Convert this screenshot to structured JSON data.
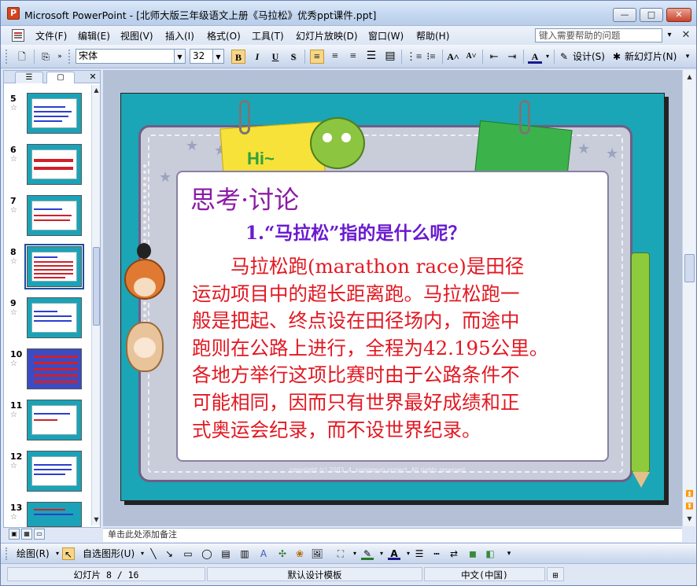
{
  "window": {
    "title": "Microsoft PowerPoint - [北师大版三年级语文上册《马拉松》优秀ppt课件.ppt]",
    "minimize": "—",
    "maximize": "□",
    "close": "✕"
  },
  "menu": {
    "items": [
      "文件(F)",
      "编辑(E)",
      "视图(V)",
      "插入(I)",
      "格式(O)",
      "工具(T)",
      "幻灯片放映(D)",
      "窗口(W)",
      "帮助(H)"
    ],
    "help_placeholder": "键入需要帮助的问题",
    "help_dropdown": "▾",
    "close_doc": "✕"
  },
  "toolbar": {
    "font_name": "宋体",
    "font_size": "32",
    "bold": "B",
    "italic": "I",
    "underline": "U",
    "shadow": "S",
    "design_label": "设计(S)",
    "new_slide_label": "新幻灯片(N)"
  },
  "thumbnails": [
    {
      "num": "5",
      "star": "☆"
    },
    {
      "num": "6",
      "star": "☆"
    },
    {
      "num": "7",
      "star": "☆"
    },
    {
      "num": "8",
      "star": "☆"
    },
    {
      "num": "9",
      "star": "☆"
    },
    {
      "num": "10",
      "star": "☆"
    },
    {
      "num": "11",
      "star": "☆"
    },
    {
      "num": "12",
      "star": "☆"
    },
    {
      "num": "13",
      "star": "☆"
    }
  ],
  "pane": {
    "tab_outline": "☰",
    "tab_slides": "▢",
    "close": "✕"
  },
  "slide": {
    "title": "思考·讨论",
    "question": "1.“马拉松”指的是什么呢？",
    "body_lines": [
      "　　马拉松跑(marathon race)是田径",
      "运动项目中的超长距离跑。马拉松跑一",
      "般是把起、终点设在田径场内，而途中",
      "跑则在公路上进行，全程为42.195公里。",
      "各地方举行这项比赛时由于公路条件不",
      "可能相同，因而只有世界最好成绩和正",
      "式奥运会纪录，而不设世界纪录。"
    ],
    "hi_text": "Hi~",
    "copyright": "copyright (c) 2003. 4. soojoosun project. All rights reserved."
  },
  "notes": {
    "text": "单击此处添加备注"
  },
  "drawbar": {
    "draw_label": "绘图(R)",
    "autoshapes_label": "自选图形(U)"
  },
  "status": {
    "slide_indicator": "幻灯片 8 / 16",
    "template": "默认设计模板",
    "language": "中文(中国)"
  },
  "colors": {
    "slide_title": "#8b1aa6",
    "question": "#6a1ad0",
    "body": "#e21822",
    "slide_bg": "#1aa6b6"
  }
}
